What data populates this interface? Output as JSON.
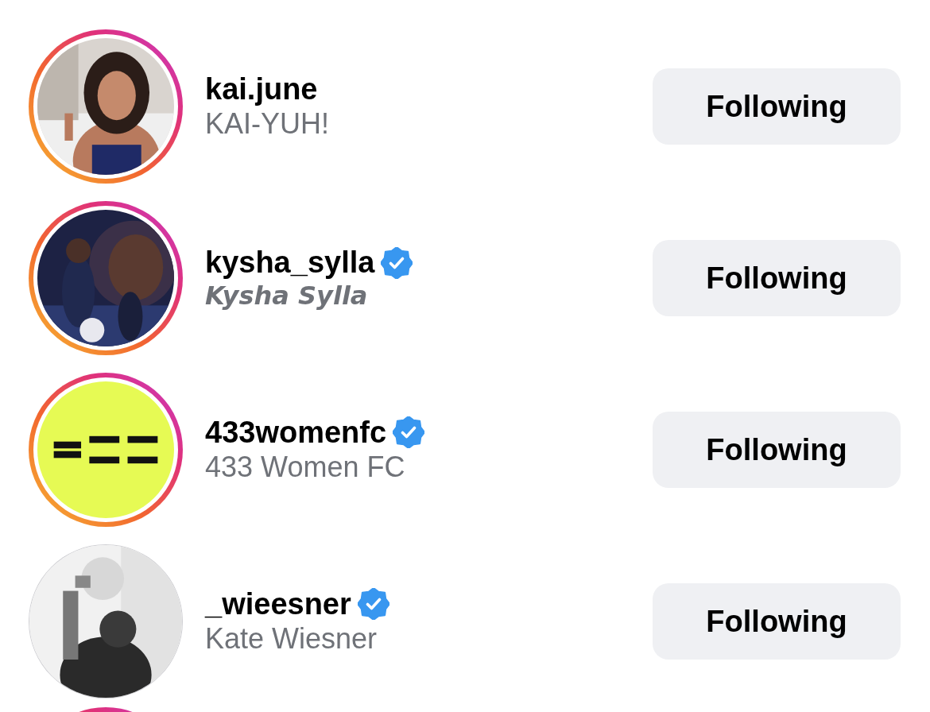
{
  "accounts": [
    {
      "username": "kai.june",
      "verified": false,
      "subtitle": "KAI-YUH!",
      "italic": false,
      "story": true,
      "button": "Following"
    },
    {
      "username": "kysha_sylla",
      "verified": true,
      "subtitle": "Kysha Sylla",
      "italic": true,
      "story": true,
      "button": "Following"
    },
    {
      "username": "433womenfc",
      "verified": true,
      "subtitle": "433 Women FC",
      "italic": false,
      "story": true,
      "button": "Following"
    },
    {
      "username": "_wieesner",
      "verified": true,
      "subtitle": "Kate Wiesner",
      "italic": false,
      "story": false,
      "button": "Following"
    }
  ],
  "next_row_peek": {
    "story": true
  }
}
